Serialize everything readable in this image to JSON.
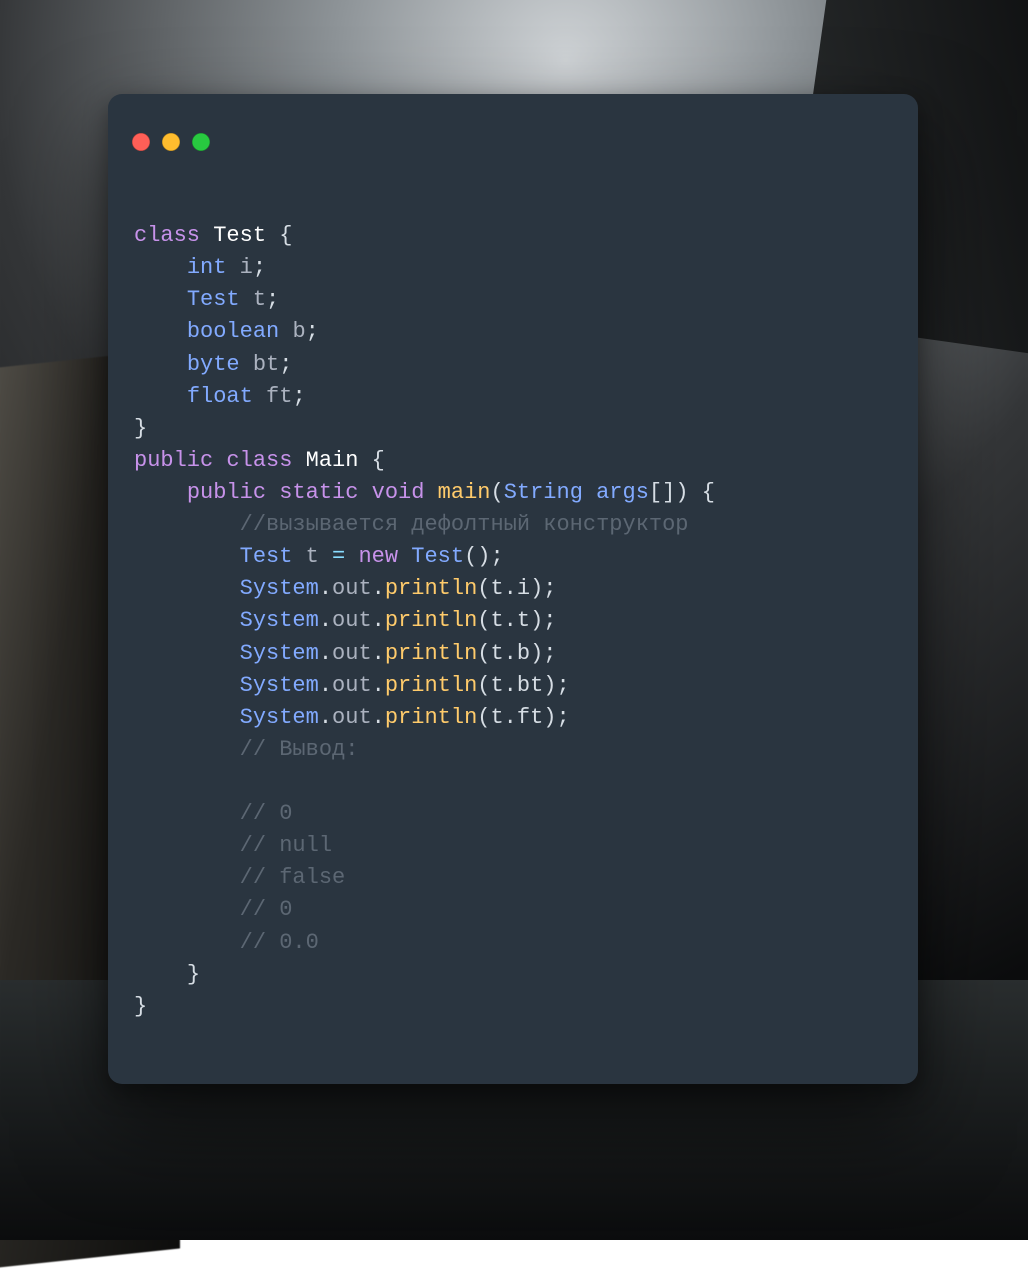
{
  "colors": {
    "terminal_bg": "#2a3540",
    "close": "#ff5f57",
    "min": "#febc2e",
    "zoom": "#28c940",
    "keyword": "#c792ea",
    "type": "#82aaff",
    "func": "#ffcb6b",
    "comment": "#5c6773",
    "text": "#d6dde4"
  },
  "code": {
    "l1": {
      "kw": "class",
      "name": "Test",
      "brace": "{"
    },
    "l2": {
      "type": "int",
      "v": "i",
      "semi": ";"
    },
    "l3": {
      "type": "Test",
      "v": "t",
      "semi": ";"
    },
    "l4": {
      "type": "boolean",
      "v": "b",
      "semi": ";"
    },
    "l5": {
      "type": "byte",
      "v": "bt",
      "semi": ";"
    },
    "l6": {
      "type": "float",
      "v": "ft",
      "semi": ";"
    },
    "l7": {
      "brace": "}"
    },
    "l8": {
      "kw1": "public",
      "kw2": "class",
      "name": "Main",
      "brace": "{"
    },
    "l9": {
      "kw1": "public",
      "kw2": "static",
      "kw3": "void",
      "fn": "main",
      "lp": "(",
      "ptype": "String",
      "pname": "args",
      "arr": "[]",
      "rp": ")",
      "brace": "{"
    },
    "l10": {
      "c": "//вызывается дефолтный конструктор"
    },
    "l11": {
      "type": "Test",
      "v": "t",
      "eq": "=",
      "kw": "new",
      "ctor": "Test",
      "call": "();"
    },
    "l12": {
      "sys": "System",
      "dot1": ".",
      "out": "out",
      "dot2": ".",
      "fn": "println",
      "arg": "(t.i);"
    },
    "l13": {
      "sys": "System",
      "dot1": ".",
      "out": "out",
      "dot2": ".",
      "fn": "println",
      "arg": "(t.t);"
    },
    "l14": {
      "sys": "System",
      "dot1": ".",
      "out": "out",
      "dot2": ".",
      "fn": "println",
      "arg": "(t.b);"
    },
    "l15": {
      "sys": "System",
      "dot1": ".",
      "out": "out",
      "dot2": ".",
      "fn": "println",
      "arg": "(t.bt);"
    },
    "l16": {
      "sys": "System",
      "dot1": ".",
      "out": "out",
      "dot2": ".",
      "fn": "println",
      "arg": "(t.ft);"
    },
    "l17": {
      "c": "// Вывод:"
    },
    "l18": {
      "c": ""
    },
    "l19": {
      "c": "// 0"
    },
    "l20": {
      "c": "// null"
    },
    "l21": {
      "c": "// false"
    },
    "l22": {
      "c": "// 0"
    },
    "l23": {
      "c": "// 0.0"
    },
    "l24": {
      "brace": "}"
    },
    "l25": {
      "brace": "}"
    }
  }
}
